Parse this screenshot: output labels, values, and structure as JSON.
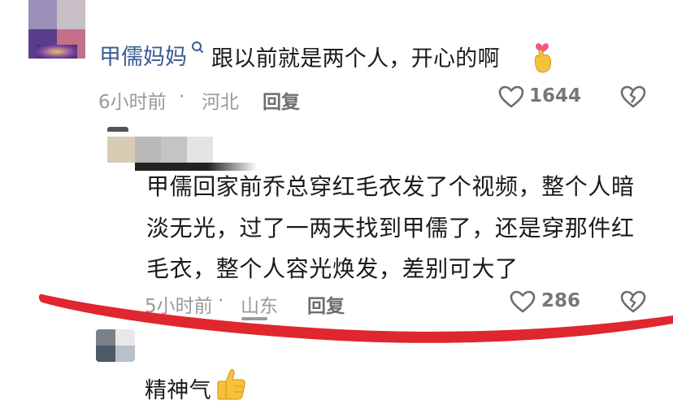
{
  "comments": [
    {
      "username": "甲儒妈妈",
      "text": "跟以前就是两个人，开心的啊",
      "time": "6小时前",
      "location": "河北",
      "reply_label": "回复",
      "likes": "1644"
    },
    {
      "lines": [
        "甲儒回家前乔总穿红毛衣发了个视频，整个人暗",
        "淡无光，过了一两天找到甲儒了，还是穿那件红",
        "毛衣，整个人容光焕发，差别可大了"
      ],
      "time": "5小时前",
      "location": "山东",
      "reply_label": "回复",
      "likes": "286"
    },
    {
      "text": "精神气"
    }
  ],
  "meta_separator": " · ",
  "icons": {
    "like": "heart-outline-icon",
    "dislike": "broken-heart-icon",
    "search_badge": "search-icon",
    "emoji_heart": "finger-heart-emoji-icon",
    "emoji_thumb": "thumbs-up-emoji-icon"
  },
  "colors": {
    "username": "#3b5b93",
    "annotation": "#e0262e"
  }
}
